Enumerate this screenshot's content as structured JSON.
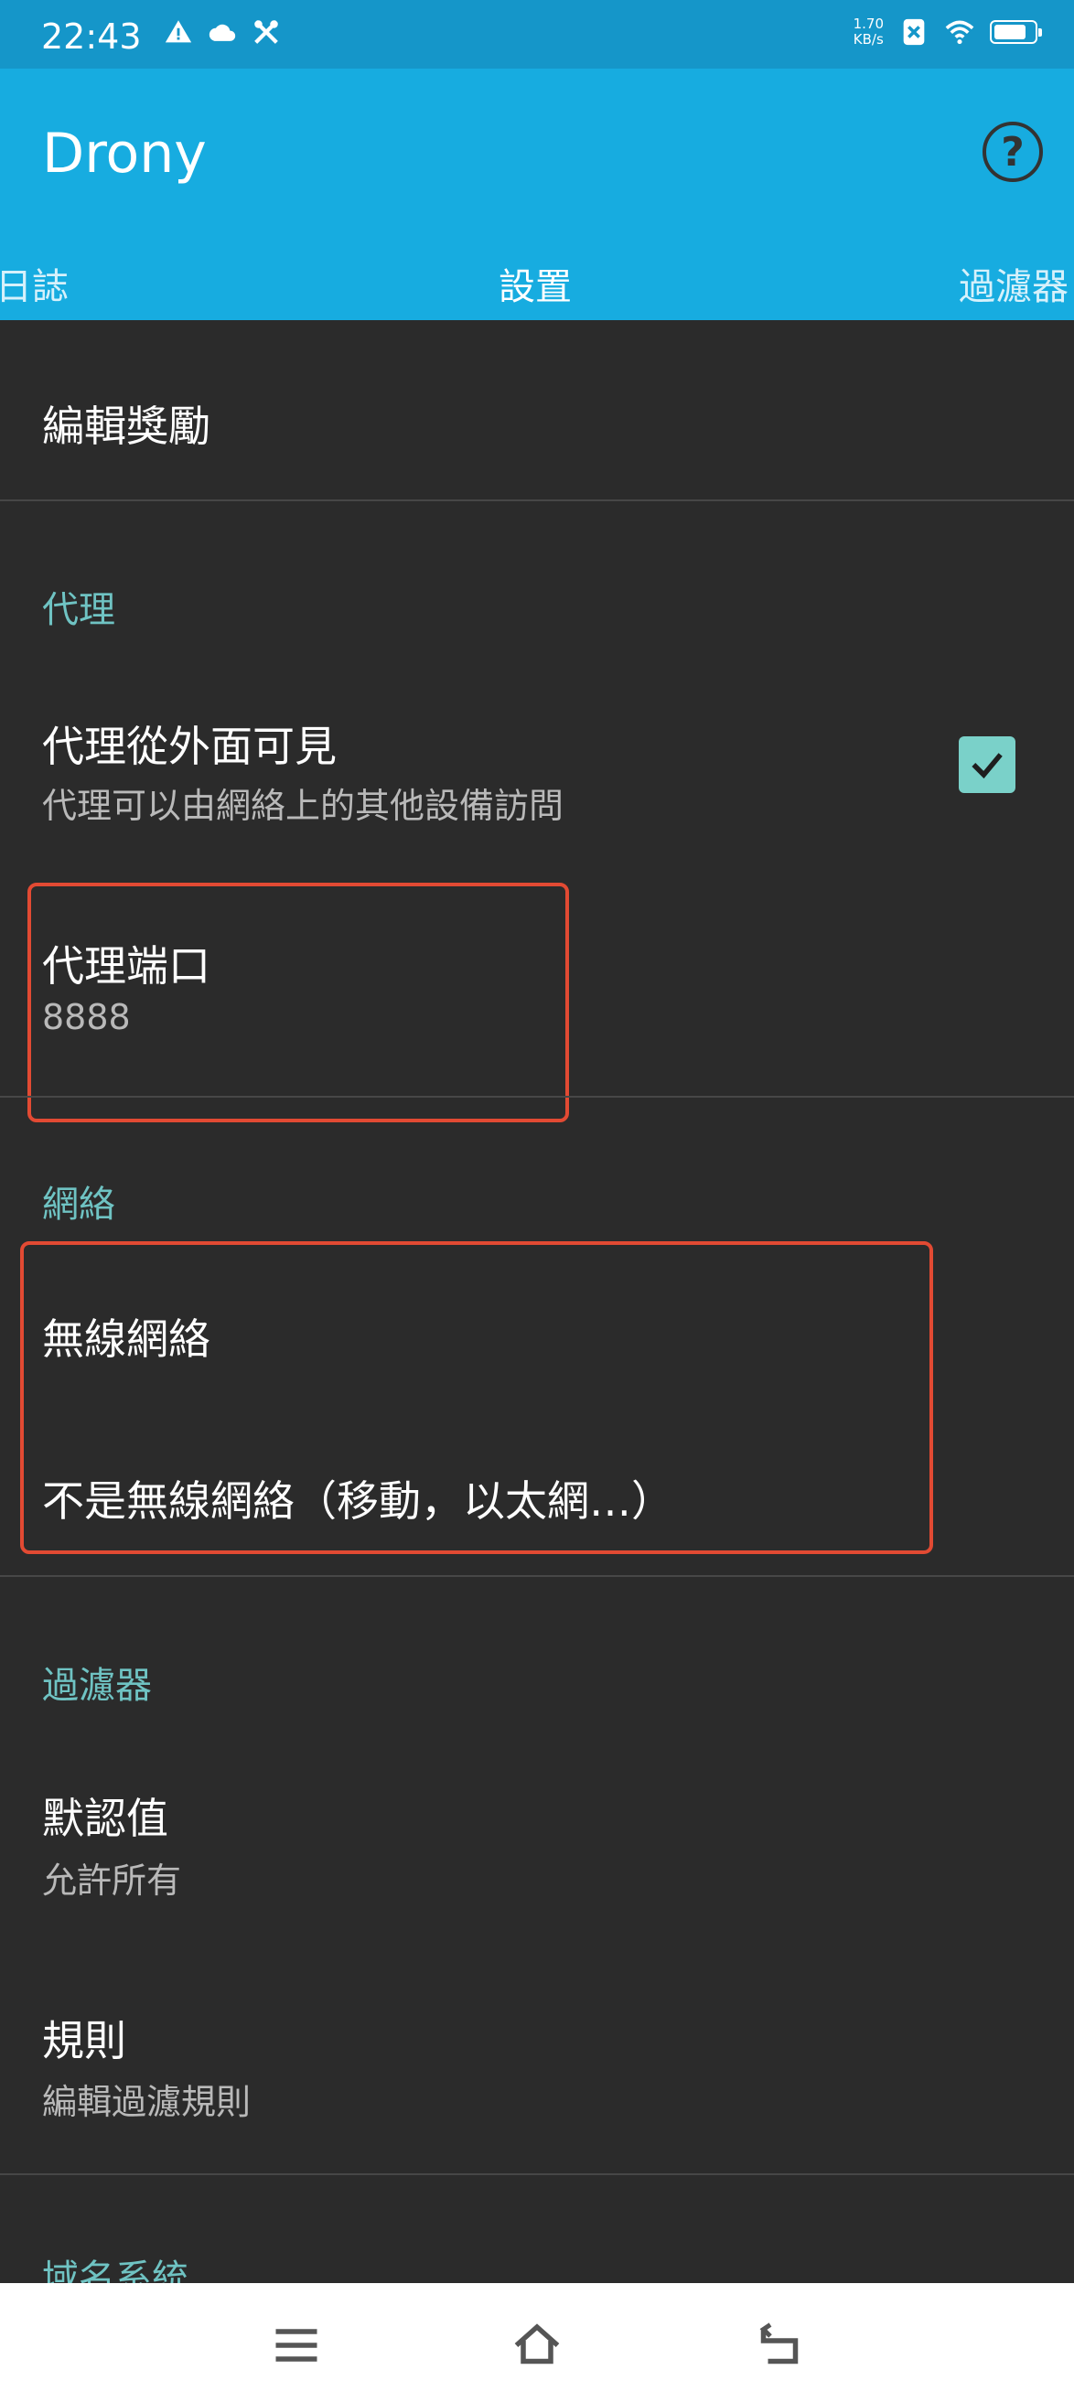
{
  "status_bar": {
    "time": "22:43",
    "net_speed_value": "1.70",
    "net_speed_unit": "KB/s",
    "icons_left": [
      "warning-icon",
      "cloud-icon",
      "tools-icon"
    ],
    "icons_right": [
      "network-speed",
      "sim-x-icon",
      "wifi-icon",
      "battery-icon"
    ]
  },
  "app_bar": {
    "title": "Drony",
    "help_label": "?"
  },
  "tabs": [
    {
      "label": "日誌",
      "active": false
    },
    {
      "label": "設置",
      "active": true
    },
    {
      "label": "過濾器",
      "active": false
    }
  ],
  "settings": {
    "edit_rewards": "編輯獎勵",
    "proxy_section": "代理",
    "proxy_visible_title": "代理從外面可見",
    "proxy_visible_subtitle": "代理可以由網絡上的其他設備訪問",
    "proxy_visible_checked": true,
    "proxy_port_title": "代理端口",
    "proxy_port_value": "8888",
    "network_section": "網絡",
    "wifi_title": "無線網絡",
    "wifi_value": "不是無線網絡（移動，以太網…）",
    "filter_section": "過濾器",
    "default_title": "默認值",
    "default_value": "允許所有",
    "rules_title": "規則",
    "rules_value": "編輯過濾規則",
    "dns_section": "域名系統"
  },
  "nav_bar": {
    "icons": [
      "menu-icon",
      "home-icon",
      "back-icon"
    ]
  },
  "colors": {
    "status_bar": "#1596c9",
    "app_bar": "#17ace0",
    "background": "#2b2b2b",
    "section_header": "#6fc3c3",
    "checkbox": "#7ad1c9",
    "highlight_box": "#e24a33"
  }
}
